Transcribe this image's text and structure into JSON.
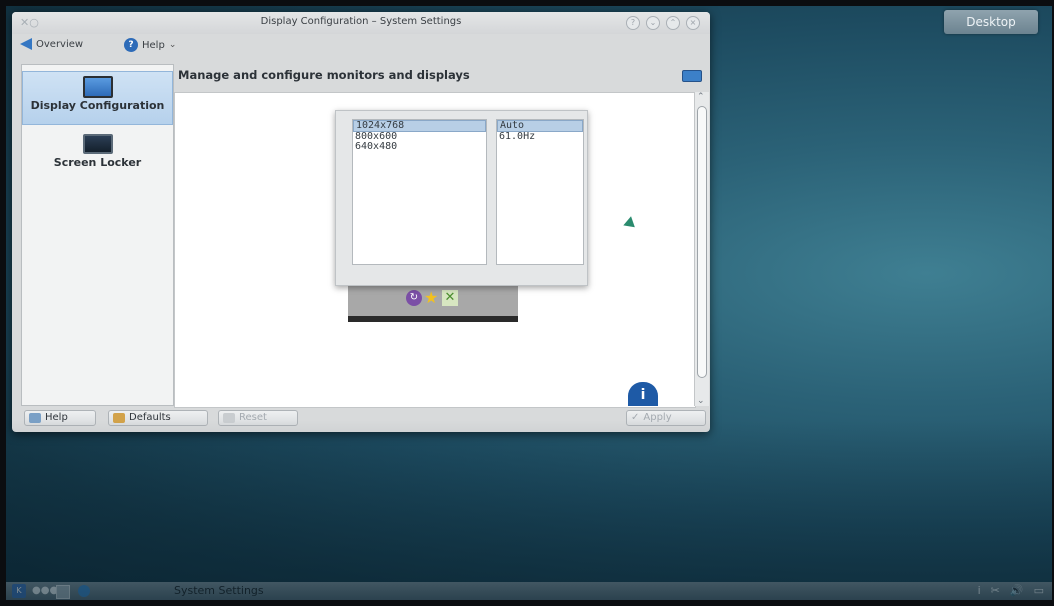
{
  "window": {
    "title": "Display Configuration – System Settings",
    "buttons": [
      "?",
      "⌄",
      "⌃",
      "×"
    ]
  },
  "toolbar": {
    "overview_label": "Overview",
    "help_label": "Help"
  },
  "sidebar": {
    "items": [
      {
        "label": "Display Configuration",
        "selected": true,
        "icon": "monitor-icon"
      },
      {
        "label": "Screen Locker",
        "selected": false,
        "icon": "screen-locker-icon"
      }
    ]
  },
  "main": {
    "heading": "Manage and configure monitors and displays"
  },
  "popup": {
    "resolutions": [
      "1024x768",
      "800x600",
      "640x480"
    ],
    "selected_resolution": "1024x768",
    "refresh_rates": [
      "Auto",
      "61.0Hz"
    ],
    "selected_rate": "Auto"
  },
  "bottom": {
    "help_label": "Help",
    "defaults_label": "Defaults",
    "reset_label": "Reset",
    "apply_label": "Apply"
  },
  "desktop": {
    "desktop_button_label": "Desktop"
  },
  "taskbar": {
    "task_label": "System Settings",
    "tray_info": "i"
  }
}
